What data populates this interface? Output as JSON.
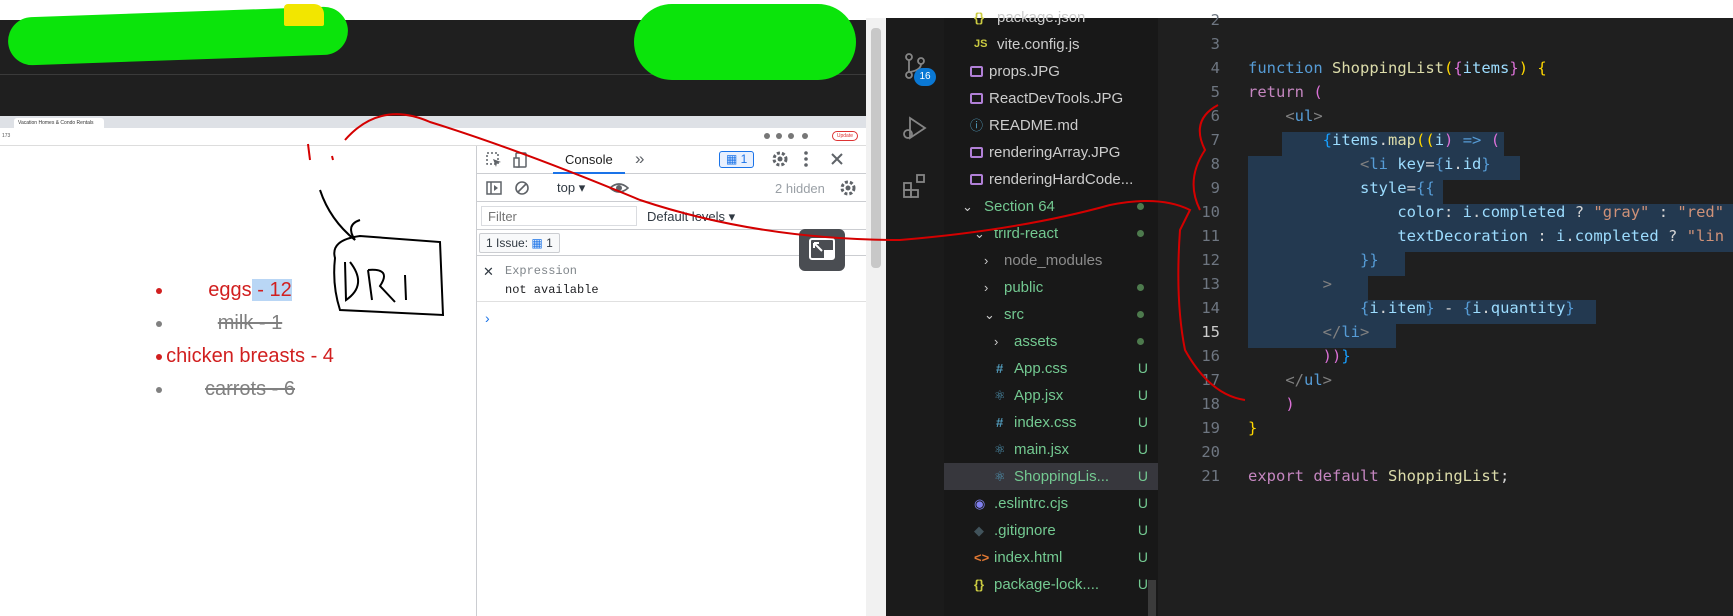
{
  "browser": {
    "tab_title": "Vacation Homes & Condo Rentals",
    "url_fragment": "173",
    "update_label": "Update"
  },
  "shopping_list": [
    {
      "text": "eggs - 12",
      "completed": false
    },
    {
      "text": "milk - 1",
      "completed": true
    },
    {
      "text": "chicken breasts - 4",
      "completed": false
    },
    {
      "text": "carrots - 6",
      "completed": true
    }
  ],
  "devtools": {
    "console_tab": "Console",
    "more_tabs": "»",
    "issue_count": "1",
    "context": "top",
    "hidden": "2 hidden",
    "filter_placeholder": "Filter",
    "levels": "Default levels",
    "issues_label": "1 Issue:",
    "issues_count": "1",
    "expression_label": "Expression",
    "expression_value": "not available",
    "prompt": "›"
  },
  "scm_badge": "16",
  "explorer": {
    "rows": [
      {
        "name": "package.json",
        "icon": "json",
        "status": ""
      },
      {
        "name": "vite.config.js",
        "icon": "js",
        "status": ""
      },
      {
        "name": "props.JPG",
        "icon": "image",
        "status": ""
      },
      {
        "name": "ReactDevTools.JPG",
        "icon": "image",
        "status": ""
      },
      {
        "name": "README.md",
        "icon": "info",
        "status": ""
      },
      {
        "name": "renderingArray.JPG",
        "icon": "image",
        "status": ""
      },
      {
        "name": "renderingHardCode...",
        "icon": "image",
        "status": ""
      },
      {
        "name": "Section 64",
        "icon": "chevron-down",
        "status": "dot"
      },
      {
        "name": "trird-react",
        "icon": "chevron-down",
        "status": "dot"
      },
      {
        "name": "node_modules",
        "icon": "chevron-right",
        "status": ""
      },
      {
        "name": "public",
        "icon": "chevron-right",
        "status": "dot"
      },
      {
        "name": "src",
        "icon": "chevron-down",
        "status": "dot"
      },
      {
        "name": "assets",
        "icon": "chevron-right",
        "status": "dot"
      },
      {
        "name": "App.css",
        "icon": "hash",
        "status": "U"
      },
      {
        "name": "App.jsx",
        "icon": "react",
        "status": "U"
      },
      {
        "name": "index.css",
        "icon": "hash",
        "status": "U"
      },
      {
        "name": "main.jsx",
        "icon": "react",
        "status": "U"
      },
      {
        "name": "ShoppingLis...",
        "icon": "react",
        "status": "U"
      },
      {
        "name": ".eslintrc.cjs",
        "icon": "eslint",
        "status": "U"
      },
      {
        "name": ".gitignore",
        "icon": "git",
        "status": "U"
      },
      {
        "name": "index.html",
        "icon": "html",
        "status": "U"
      },
      {
        "name": "package-lock....",
        "icon": "json",
        "status": "U"
      }
    ]
  },
  "editor": {
    "current_line": 15,
    "line_numbers": [
      "2",
      "3",
      "4",
      "5",
      "6",
      "7",
      "8",
      "9",
      "10",
      "11",
      "12",
      "13",
      "14",
      "15",
      "16",
      "17",
      "18",
      "19",
      "20",
      "21"
    ],
    "lines": {
      "l4": [
        "function",
        "ShoppingList",
        "(",
        "{",
        "items",
        "}",
        ")",
        "{"
      ],
      "l5": [
        "return",
        "("
      ],
      "l6": [
        "<",
        "ul",
        ">"
      ],
      "l7": [
        "{",
        "items",
        ".",
        "map",
        "((",
        "i",
        ")",
        "=>",
        "("
      ],
      "l8": [
        "<",
        "li",
        "key",
        "=",
        "{",
        "i",
        ".",
        "id",
        "}"
      ],
      "l9": [
        "style",
        "=",
        "{{"
      ],
      "l10": [
        "color",
        ":",
        "i",
        ".",
        "completed",
        "?",
        "\"gray\"",
        ":",
        "\"red\""
      ],
      "l11": [
        "textDecoration",
        ":",
        "i",
        ".",
        "completed",
        "?",
        "\"lin"
      ],
      "l12": [
        "}}"
      ],
      "l13": [
        ">"
      ],
      "l14": [
        "{",
        "i",
        ".",
        "item",
        "}",
        "-",
        "{",
        "i",
        ".",
        "quantity",
        "}"
      ],
      "l15": [
        "</",
        "li",
        ">"
      ],
      "l16": [
        "))",
        "}"
      ],
      "l17": [
        "</",
        "ul",
        ">"
      ],
      "l18": [
        ")"
      ],
      "l19": [
        "}"
      ],
      "l21": [
        "export",
        "default",
        "ShoppingList",
        ";"
      ]
    }
  },
  "colors": {
    "todo": "#d11f1f",
    "done": "#808080",
    "annotation": "#d40000",
    "scribble": "#0be40b"
  }
}
